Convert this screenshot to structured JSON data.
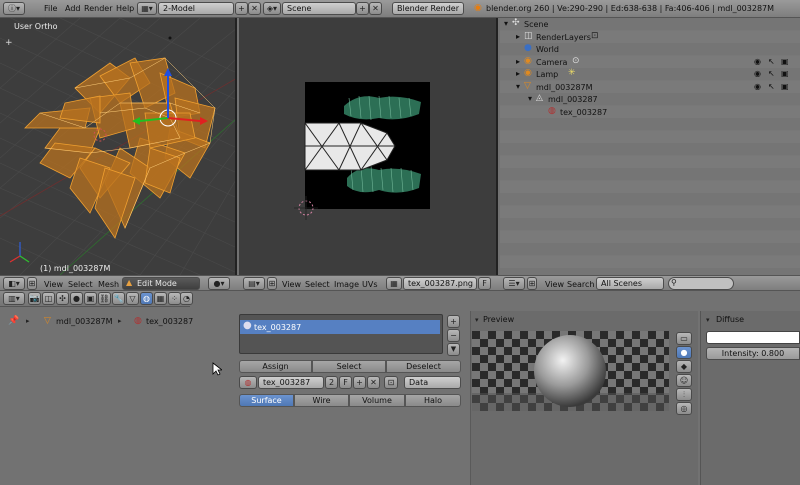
{
  "topbar": {
    "menus": [
      "File",
      "Add",
      "Render",
      "Help"
    ],
    "layout": "2-Model",
    "scene": "Scene",
    "engine": "Blender Render",
    "stats": "blender.org 260 | Ve:290-290 | Ed:638-638 | Fa:406-406 | mdl_003287M"
  },
  "viewport3d": {
    "label": "User Ortho",
    "object_label": "(1) mdl_003287M",
    "header": {
      "menus": [
        "View",
        "Select",
        "Mesh"
      ],
      "mode": "Edit Mode"
    }
  },
  "image_editor": {
    "header": {
      "menus": [
        "View",
        "Select",
        "Image",
        "UVs"
      ],
      "image": "tex_003287.png",
      "fake": "F"
    }
  },
  "outliner": {
    "items": [
      {
        "label": "Scene",
        "indent": 0
      },
      {
        "label": "RenderLayers",
        "indent": 1
      },
      {
        "label": "World",
        "indent": 1
      },
      {
        "label": "Camera",
        "indent": 1
      },
      {
        "label": "Lamp",
        "indent": 1
      },
      {
        "label": "mdl_003287M",
        "indent": 1
      },
      {
        "label": "mdl_003287",
        "indent": 2
      },
      {
        "label": "tex_003287",
        "indent": 3
      }
    ],
    "header": {
      "menus": [
        "View",
        "Search"
      ],
      "filter": "All Scenes"
    }
  },
  "properties": {
    "breadcrumb": {
      "object": "mdl_003287M",
      "material": "tex_003287"
    },
    "slot": "tex_003287",
    "buttons": {
      "assign": "Assign",
      "select": "Select",
      "deselect": "Deselect"
    },
    "material": {
      "name": "tex_003287",
      "users": "2",
      "fake": "F",
      "link": "Data"
    },
    "tabs": [
      "Surface",
      "Wire",
      "Volume",
      "Halo"
    ],
    "active_tab": "Surface",
    "preview_label": "Preview",
    "diffuse_label": "Diffuse",
    "intensity": "Intensity: 0.800"
  },
  "colors": {
    "accent": "#5680c2",
    "wire": "#f0a030",
    "viewport_bg": "#3d3d3d"
  }
}
